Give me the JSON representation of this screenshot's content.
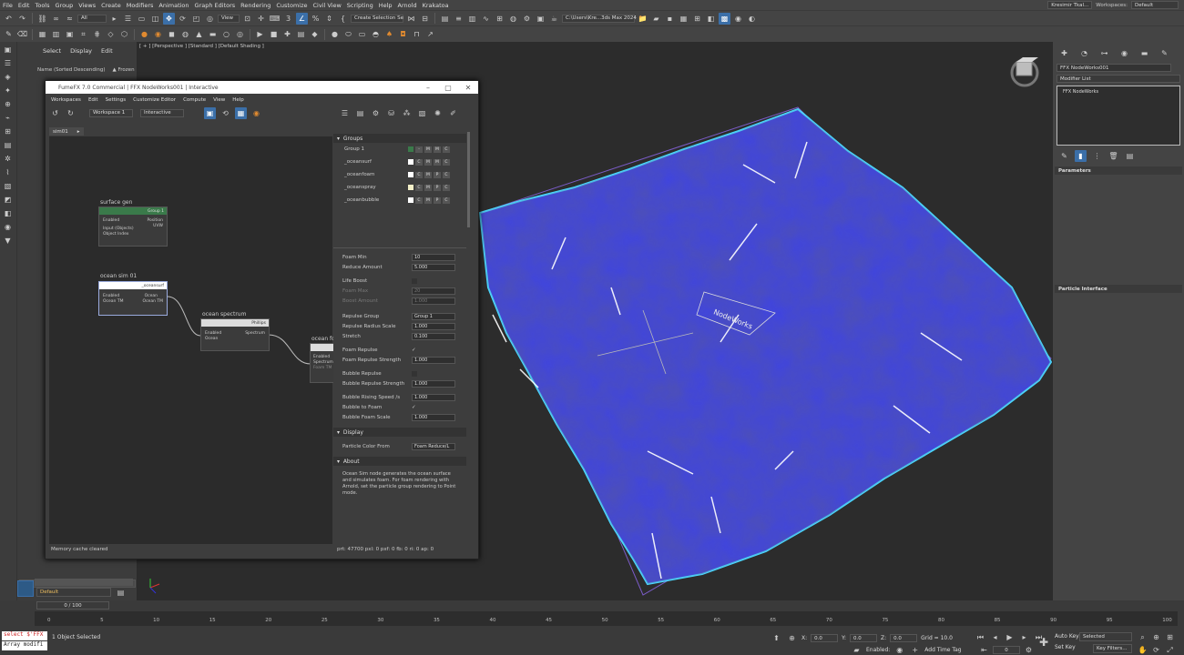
{
  "menu": [
    "File",
    "Edit",
    "Tools",
    "Group",
    "Views",
    "Create",
    "Modifiers",
    "Animation",
    "Graph Editors",
    "Rendering",
    "Customize",
    "Civil View",
    "Scripting",
    "Help",
    "Arnold",
    "Krakatoa"
  ],
  "user": "Kresimir Tkal...",
  "workspaces_label": "Workspaces:",
  "workspaces_value": "Default",
  "toolbar": {
    "filter": "All",
    "view": "View",
    "selection_set": "Create Selection Se",
    "path": "C:\\Users\\Kre...3ds Max 2024"
  },
  "scene_explorer": {
    "tabs": [
      "Select",
      "Display",
      "Edit"
    ],
    "sort": "Name (Sorted Descending)",
    "frozen": "▲ Frozen"
  },
  "viewport_label": "[ + ] [Perspective ] [Standard ] [Default Shading ]",
  "command_panel": {
    "object_name": "FFX NodeWorks001",
    "modifier_list": "Modifier List",
    "stack_item": "FFX NodeWorks",
    "rollouts": [
      "Parameters",
      "Particle Interface"
    ]
  },
  "ffx": {
    "title": "FumeFX 7.0 Commercial | FFX NodeWorks001 | Interactive",
    "menu": [
      "Workspaces",
      "Edit",
      "Settings",
      "Customize Editor",
      "Compute",
      "View",
      "Help"
    ],
    "workspace": "Workspace 1",
    "mode": "Interactive",
    "tab": "sim01",
    "status_left": "Memory cache cleared",
    "status_right": "prt: 47700 pxl: 0 pxf: 0 fb: 0 ri: 0 ap: 0",
    "nodes": {
      "surface_gen": {
        "label": "surface gen",
        "header": "Group 1",
        "in": [
          "Enabled",
          "Input (Objects)",
          "Object Index"
        ],
        "out": [
          "Position",
          "UVW"
        ]
      },
      "ocean_sim": {
        "label": "ocean sim 01",
        "header": "_oceansurf",
        "in": [
          "Enabled",
          "Ocean TM"
        ],
        "out": [
          "Ocean",
          "Ocean TM"
        ]
      },
      "ocean_spectrum": {
        "label": "ocean spectrum",
        "header": "Phillips",
        "in": [
          "Enabled",
          "Ocean"
        ],
        "out": [
          "Spectrum"
        ]
      },
      "ocean_fx": {
        "label": "ocean fo",
        "in": [
          "Enabled",
          "Spectrum",
          "Foam TM"
        ]
      }
    },
    "groups_title": "Groups",
    "groups": [
      {
        "name": "Group 1",
        "color": "#3a7a4a",
        "b": [
          "-",
          "M",
          "M",
          "C"
        ]
      },
      {
        "name": "_oceansurf",
        "color": "#ffffff",
        "b": [
          "C",
          "M",
          "M",
          "C"
        ]
      },
      {
        "name": "_oceanfoam",
        "color": "#ffffff",
        "b": [
          "C",
          "M",
          "P",
          "C"
        ]
      },
      {
        "name": "_oceanspray",
        "color": "#f3f0c8",
        "b": [
          "C",
          "M",
          "P",
          "C"
        ]
      },
      {
        "name": "_oceanbubble",
        "color": "#ffffff",
        "b": [
          "C",
          "M",
          "P",
          "C"
        ]
      }
    ],
    "params": [
      {
        "label": "Foam Min",
        "value": "10"
      },
      {
        "label": "Reduce Amount",
        "value": "5.000"
      },
      {
        "label": "Life Boost",
        "check": ""
      },
      {
        "label": "Foam Max",
        "value": "20",
        "dim": true
      },
      {
        "label": "Boost Amount",
        "value": "1.000",
        "dim": true
      },
      {
        "label": "Repulse Group",
        "value": "Group 1"
      },
      {
        "label": "Repulse Radius Scale",
        "value": "1.000"
      },
      {
        "label": "Stretch",
        "value": "0.100"
      },
      {
        "label": "Foam Repulse",
        "check": "✓"
      },
      {
        "label": "Foam Repulse Strength",
        "value": "1.000"
      },
      {
        "label": "Bubble Repulse",
        "check": ""
      },
      {
        "label": "Bubble Repulse Strength",
        "value": "1.000"
      },
      {
        "label": "Bubble Rising Speed /s",
        "value": "1.000"
      },
      {
        "label": "Bubble to Foam",
        "check": "✓"
      },
      {
        "label": "Bubble Foam Scale",
        "value": "1.000"
      }
    ],
    "display_title": "Display",
    "particle_color_label": "Particle Color From",
    "particle_color_value": "Foam Reduce/L",
    "about_title": "About",
    "about_text": "Ocean Sim node generates the ocean surface and simulates foam. For foam rendering with Arnold, set the particle group rendering to Point mode."
  },
  "gizmo_text": "NodeWorks",
  "bottom": {
    "layer": "Default",
    "frame": "0 / 100",
    "ticks": [
      "0",
      "5",
      "10",
      "15",
      "20",
      "25",
      "30",
      "35",
      "40",
      "45",
      "50",
      "55",
      "60",
      "65",
      "70",
      "75",
      "80",
      "85",
      "90",
      "95",
      "100"
    ],
    "selected": "1 Object Selected",
    "script1": "select $'FFX",
    "script2": "Array modifi",
    "x_label": "X:",
    "x": "0.0",
    "y_label": "Y:",
    "y": "0.0",
    "z_label": "Z:",
    "z": "0.0",
    "grid": "Grid = 10.0",
    "enabled": "Enabled:",
    "add_time_tag": "Add Time Tag",
    "auto_key": "Auto Key",
    "set_key": "Set Key",
    "selected_dd": "Selected",
    "key_filters": "Key Filters...",
    "frame_num": "0"
  },
  "colors": {
    "ocean": "#3f44e0",
    "highlight": "#4ad8ff",
    "accent": "#3b6fa8"
  }
}
